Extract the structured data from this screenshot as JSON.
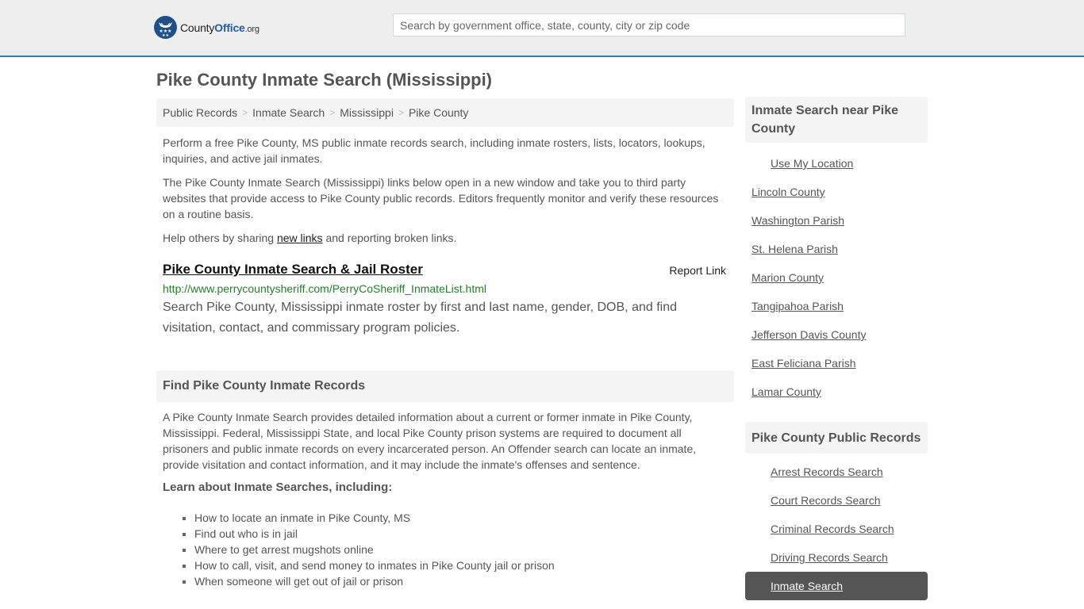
{
  "header": {
    "logo": {
      "name": "County",
      "accent": "Office",
      "suffix": ".org",
      "icon": "eagle-stars-icon"
    },
    "search_placeholder": "Search by government office, state, county, city or zip code",
    "search_value": ""
  },
  "page_title": "Pike County Inmate Search (Mississippi)",
  "breadcrumb": [
    {
      "label": "Public Records"
    },
    {
      "label": "Inmate Search"
    },
    {
      "label": "Mississippi"
    },
    {
      "label": "Pike County"
    }
  ],
  "breadcrumb_sep": ">",
  "intro": {
    "p1": "Perform a free Pike County, MS public inmate records search, including inmate rosters, lists, locators, lookups, inquiries, and active jail inmates.",
    "p2": "The Pike County Inmate Search (Mississippi) links below open in a new window and take you to third party websites that provide access to Pike County public records. Editors frequently monitor and verify these resources on a routine basis.",
    "p3_before": "Help others by sharing ",
    "p3_link": "new links",
    "p3_after": " and reporting broken links."
  },
  "result": {
    "title": "Pike County Inmate Search & Jail Roster",
    "report_label": "Report Link",
    "url": "http://www.perrycountysheriff.com/PerryCoSheriff_InmateList.html",
    "description": "Search Pike County, Mississippi inmate roster by first and last name, gender, DOB, and find visitation, contact, and commissary program policies."
  },
  "records_section": {
    "heading": "Find Pike County Inmate Records",
    "paragraph": "A Pike County Inmate Search provides detailed information about a current or former inmate in Pike County, Mississippi. Federal, Mississippi State, and local Pike County prison systems are required to document all prisoners and public inmate records on every incarcerated person. An Offender search can locate an inmate, provide visitation and contact information, and it may include the inmate's offenses and sentence.",
    "learn_heading": "Learn about Inmate Searches, including:",
    "bullets": [
      "How to locate an inmate in Pike County, MS",
      "Find out who is in jail",
      "Where to get arrest mugshots online",
      "How to call, visit, and send money to inmates in Pike County jail or prison",
      "When someone will get out of jail or prison"
    ]
  },
  "sidebar": {
    "nearby_heading": "Inmate Search near Pike County",
    "use_location": "Use My Location",
    "nearby": [
      "Lincoln County",
      "Washington Parish",
      "St. Helena Parish",
      "Marion County",
      "Tangipahoa Parish",
      "Jefferson Davis County",
      "East Feliciana Parish",
      "Lamar County"
    ],
    "records_heading": "Pike County Public Records",
    "records": [
      "Arrest Records Search",
      "Court Records Search",
      "Criminal Records Search",
      "Driving Records Search",
      "Inmate Search"
    ],
    "active_record": "Inmate Search"
  },
  "colors": {
    "accent_border": "#337ab7",
    "logo_blue": "#1e4f8c",
    "url_green": "#267e2a",
    "active_bg": "#555555"
  }
}
